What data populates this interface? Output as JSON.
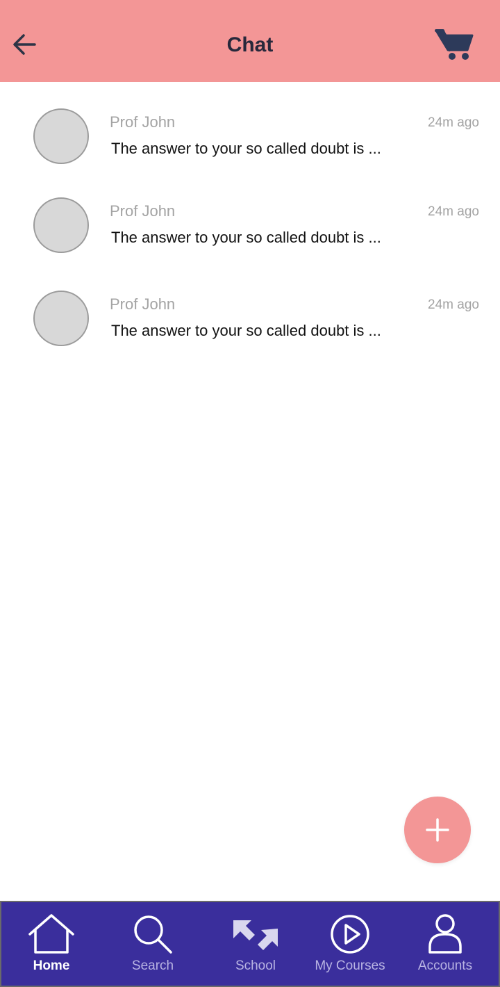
{
  "header": {
    "title": "Chat",
    "back_icon": "arrow-left-icon",
    "cart_icon": "cart-icon",
    "bg_color": "#f39696"
  },
  "chats": [
    {
      "sender": "Prof John",
      "time": "24m ago",
      "preview": "The answer to your so called doubt is ..."
    },
    {
      "sender": "Prof John",
      "time": "24m ago",
      "preview": "The answer to your so called doubt is ..."
    },
    {
      "sender": "Prof John",
      "time": "24m ago",
      "preview": "The answer to your so called doubt is ..."
    }
  ],
  "fab": {
    "icon": "plus-icon"
  },
  "nav": {
    "bg_color": "#3a2e9c",
    "items": [
      {
        "label": "Home",
        "icon": "home-icon",
        "active": true
      },
      {
        "label": "Search",
        "icon": "search-icon",
        "active": false
      },
      {
        "label": "School",
        "icon": "school-icon",
        "active": false
      },
      {
        "label": "My Courses",
        "icon": "play-circle-icon",
        "active": false
      },
      {
        "label": "Accounts",
        "icon": "user-icon",
        "active": false
      }
    ]
  }
}
